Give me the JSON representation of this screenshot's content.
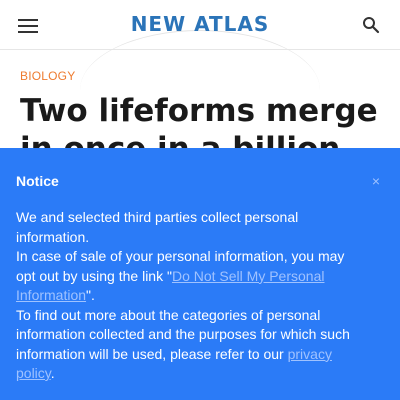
{
  "header": {
    "logo_text": "NEW ATLAS",
    "menu_icon": "hamburger-menu-icon",
    "search_icon": "search-icon"
  },
  "article": {
    "category": "BIOLOGY",
    "headline": "Two lifeforms merge in once in a billion years"
  },
  "notice": {
    "title": "Notice",
    "close_glyph": "×",
    "para1": "We and selected third parties collect personal information.",
    "para2_prefix": "In case of sale of your personal information, you may opt out by using the link \"",
    "opt_out_link": "Do Not Sell My Personal Information",
    "para2_suffix": "\".",
    "para3_prefix": "To find out more about the categories of personal information collected and the purposes for which such information will be used, please refer to our ",
    "privacy_link": "privacy policy",
    "para3_suffix": ".",
    "background_color": "#2b7bf7"
  }
}
